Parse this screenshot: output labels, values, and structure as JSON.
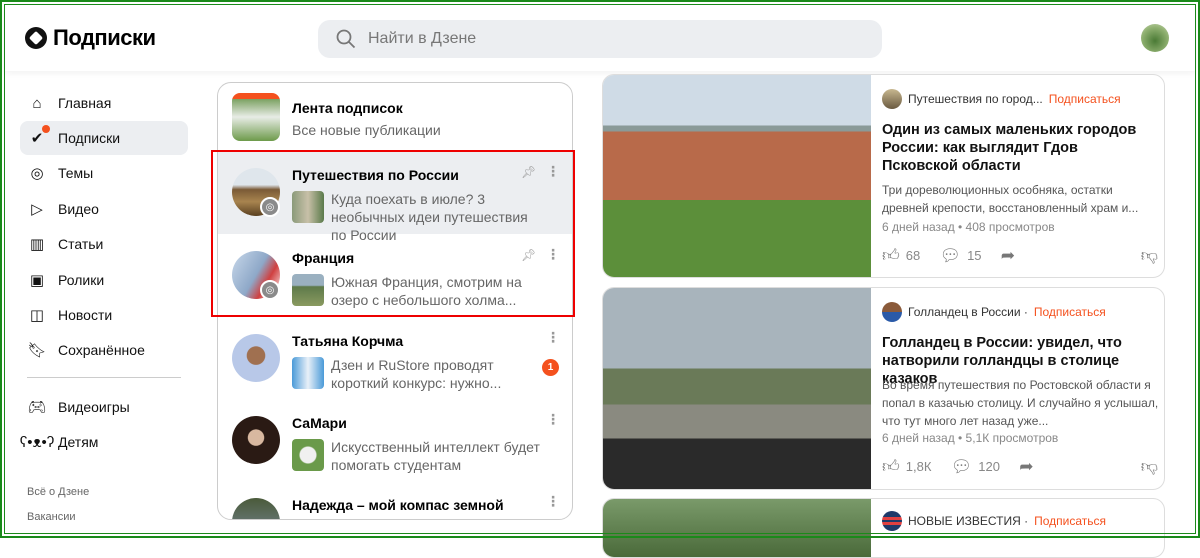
{
  "header": {
    "title": "Подписки",
    "search_placeholder": "Найти в Дзене"
  },
  "sidebar": {
    "items": [
      {
        "label": "Главная",
        "icon": "home-icon"
      },
      {
        "label": "Подписки",
        "icon": "subscriptions-icon",
        "active": true
      },
      {
        "label": "Темы",
        "icon": "compass-icon"
      },
      {
        "label": "Видео",
        "icon": "video-icon"
      },
      {
        "label": "Статьи",
        "icon": "book-icon"
      },
      {
        "label": "Ролики",
        "icon": "shorts-icon"
      },
      {
        "label": "Новости",
        "icon": "news-icon"
      },
      {
        "label": "Сохранённое",
        "icon": "bookmark-icon"
      },
      {
        "label": "Видеоигры",
        "icon": "gamepad-icon"
      },
      {
        "label": "Детям",
        "icon": "bear-icon"
      }
    ],
    "links": [
      "Всё о Дзене",
      "Вакансии"
    ]
  },
  "subscriptions": [
    {
      "name": "Лента подписок",
      "text": "Все новые публикации"
    },
    {
      "name": "Путешествия по России",
      "text": "Куда поехать в июле? 3 необычных идеи путешествия по России",
      "pinned": true
    },
    {
      "name": "Франция",
      "text": "Южная Франция, смотрим на озеро с небольшого холма...",
      "pinned": true
    },
    {
      "name": "Татьяна Корчма",
      "text": "Дзен и RuStore проводят короткий конкурс: нужно...",
      "badge": "1"
    },
    {
      "name": "СаМари",
      "text": "Искусственный интеллект будет помогать студентам"
    },
    {
      "name": "Надежда – мой компас земной",
      "text": ""
    }
  ],
  "feed": [
    {
      "channel": "Путешествия по город...",
      "subscribe": "Подписаться",
      "title": "Один из самых маленьких городов России: как выглядит Гдов Псковской области",
      "desc": "Три дореволюционных особняка, остатки древней крепости, восстановленный храм и...",
      "meta": "6 дней назад • 408 просмотров",
      "likes": "68",
      "comments": "15"
    },
    {
      "channel": "Голландец в России · ",
      "subscribe": "Подписаться",
      "title": "Голландец в России: увидел, что натворили голландцы в столице казаков",
      "desc": "Во время путешествия по Ростовской области я попал в казачью столицу. И случайно я услышал, что тут много лет назад уже...",
      "meta": "6 дней назад • 5,1К просмотров",
      "likes": "1,8К",
      "comments": "120"
    },
    {
      "channel": "НОВЫЕ ИЗВЕСТИЯ · ",
      "subscribe": "Подписаться"
    }
  ],
  "colors": {
    "accent": "#f4511e",
    "highlight": "#e00000",
    "frame": "#1a8a1a"
  }
}
